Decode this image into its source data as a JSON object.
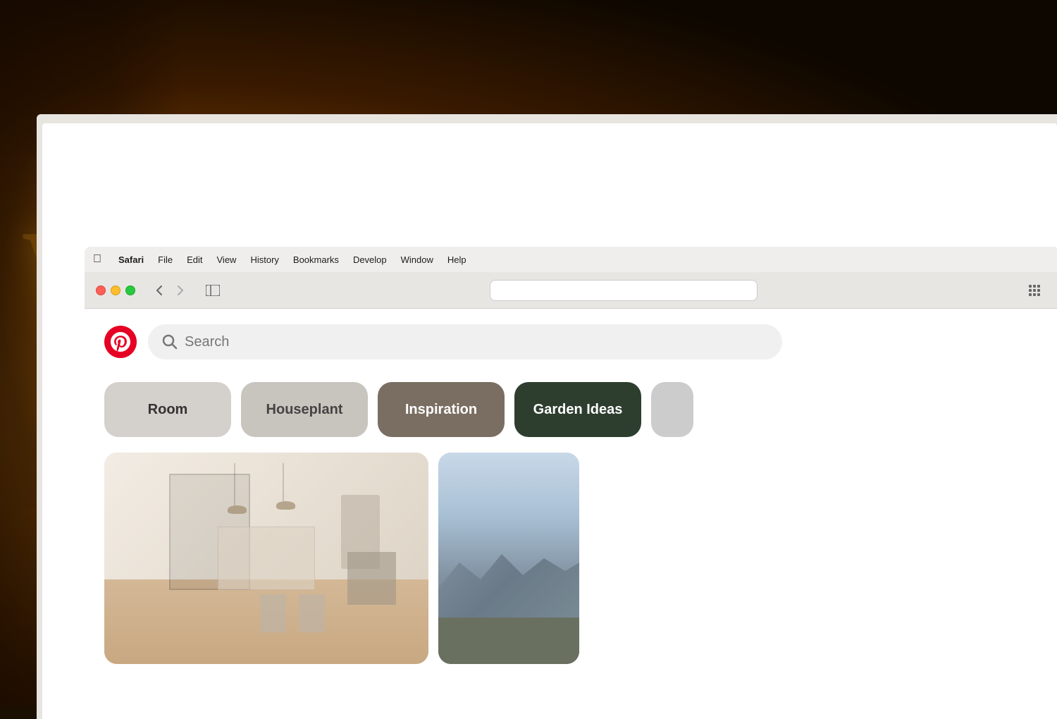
{
  "background": {
    "color": "#1a0f00"
  },
  "menubar": {
    "apple_symbol": "⌘",
    "items": [
      {
        "label": "Safari",
        "bold": true
      },
      {
        "label": "File"
      },
      {
        "label": "Edit"
      },
      {
        "label": "View"
      },
      {
        "label": "History"
      },
      {
        "label": "Bookmarks"
      },
      {
        "label": "Develop"
      },
      {
        "label": "Window"
      },
      {
        "label": "Help"
      }
    ]
  },
  "browser": {
    "back_arrow": "‹",
    "forward_arrow": "›",
    "sidebar_icon": "⬜"
  },
  "pinterest": {
    "logo_color": "#e60023",
    "search_placeholder": "Search",
    "categories": [
      {
        "label": "Room",
        "style": "light-gray"
      },
      {
        "label": "Houseplant",
        "style": "mid-gray"
      },
      {
        "label": "Inspiration",
        "style": "dark-gray"
      },
      {
        "label": "Garden Ideas",
        "style": "dark-green"
      }
    ]
  },
  "lamp_letter": "W"
}
